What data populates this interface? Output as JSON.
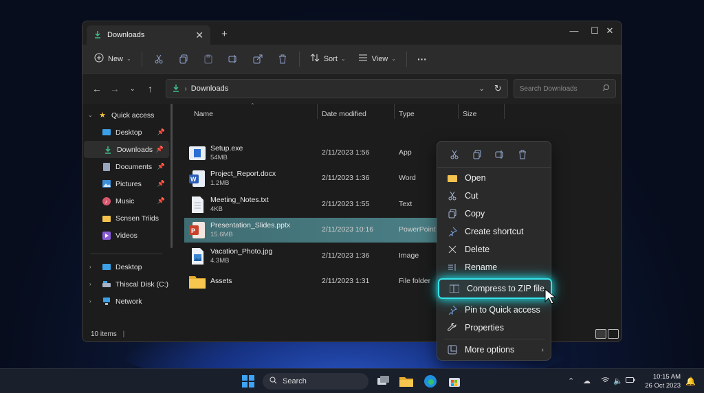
{
  "window": {
    "tab_title": "Downloads",
    "new_tab": "+",
    "controls": [
      "—",
      "☐",
      "✕"
    ]
  },
  "toolbar": {
    "new_label": "New",
    "sort_label": "Sort",
    "view_label": "View",
    "more_label": "···"
  },
  "address": {
    "path": "Downloads",
    "search_placeholder": "Search Downloads"
  },
  "sidebar": {
    "quick_access": "Quick access",
    "items": [
      {
        "label": "Desktop",
        "icon": "desktop-icon"
      },
      {
        "label": "Downloads",
        "icon": "download-icon"
      },
      {
        "label": "Documents",
        "icon": "documents-icon"
      },
      {
        "label": "Pictures",
        "icon": "pictures-icon"
      },
      {
        "label": "Music",
        "icon": "music-icon"
      },
      {
        "label": "Scnsen Triids",
        "icon": "folder-icon"
      },
      {
        "label": "Videos",
        "icon": "videos-icon"
      }
    ],
    "roots": [
      {
        "label": "Desktop",
        "icon": "desktop-icon"
      },
      {
        "label": "Thiscal Disk (C:)",
        "icon": "drive-icon"
      },
      {
        "label": "Network",
        "icon": "network-icon"
      }
    ]
  },
  "columns": {
    "name": "Name",
    "date": "Date modified",
    "type": "Type",
    "size": "Size"
  },
  "files": [
    {
      "name": "Setup.exe",
      "size": "54MB",
      "date": "2/11/2023 1:56",
      "type": "App",
      "icon": "exe-icon"
    },
    {
      "name": "Project_Report.docx",
      "size": "1.2MB",
      "date": "2/11/2023 1:36",
      "type": "Word",
      "icon": "word-icon"
    },
    {
      "name": "Meeting_Notes.txt",
      "size": "4KB",
      "date": "2/11/2023 1:55",
      "type": "Text",
      "icon": "text-file-icon"
    },
    {
      "name": "Presentation_Slides.pptx",
      "size": "15.6MB",
      "date": "2/11/2023 10:16",
      "type": "PowerPoint",
      "icon": "powerpoint-icon"
    },
    {
      "name": "Vacation_Photo.jpg",
      "size": "4.3MB",
      "date": "2/11/2023 1:36",
      "type": "Image",
      "icon": "image-icon"
    },
    {
      "name": "Assets",
      "size": "",
      "date": "2/11/2023 1:31",
      "type": "File folder",
      "icon": "folder-icon"
    }
  ],
  "status": {
    "items_count": "10 items"
  },
  "context_menu": {
    "items": [
      {
        "label": "Open",
        "icon": "open-folder-icon"
      },
      {
        "label": "Cut",
        "icon": "cut-icon"
      },
      {
        "label": "Copy",
        "icon": "copy-icon"
      },
      {
        "label": "Create shortcut",
        "icon": "shortcut-icon"
      },
      {
        "label": "Delete",
        "icon": "close-icon"
      },
      {
        "label": "Rename",
        "icon": "rename-icon"
      },
      {
        "label": "Compress to ZIP file",
        "icon": "zip-icon"
      },
      {
        "label": "Pin to Quick access",
        "icon": "pin-icon"
      },
      {
        "label": "Properties",
        "icon": "wrench-icon"
      },
      {
        "label": "More options",
        "icon": "more-options-icon"
      }
    ],
    "highlight_color": "#34e3ea"
  },
  "taskbar": {
    "search_label": "Search",
    "time": "10:15 AM",
    "date": "26 Oct 2023"
  }
}
